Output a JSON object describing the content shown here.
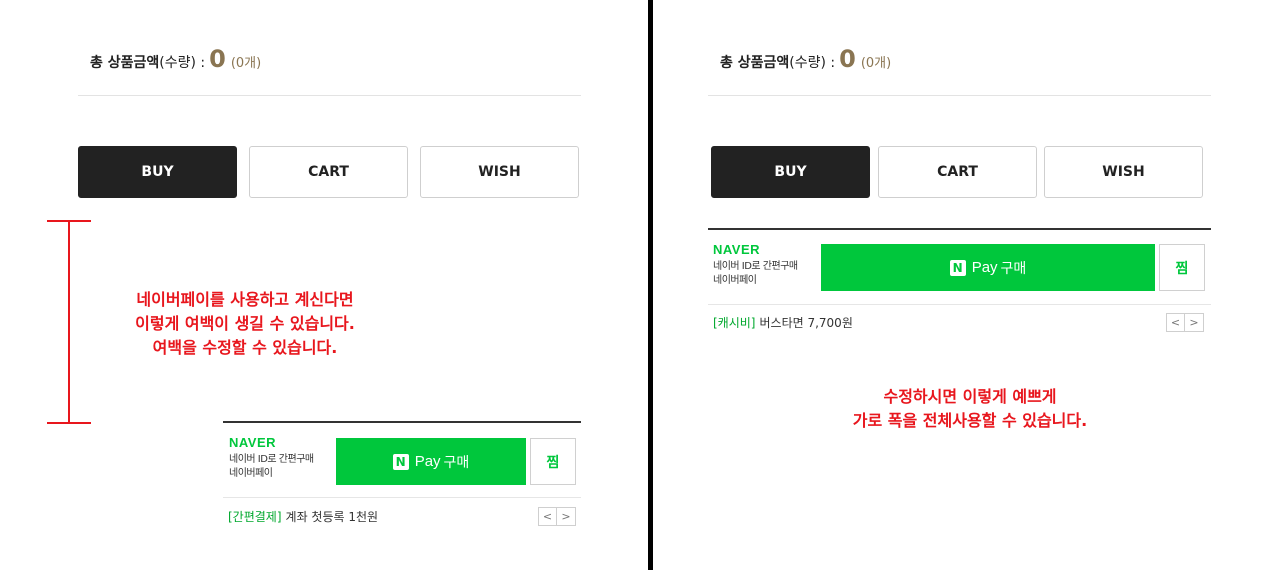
{
  "left": {
    "total": {
      "label_bold": "총 상품금액",
      "label_rest": "(수량) :",
      "amount": "0",
      "count": "(0개)"
    },
    "buttons": {
      "buy": "BUY",
      "cart": "CART",
      "wish": "WISH"
    },
    "annotation": {
      "line1": "네이버페이를 사용하고 계신다면",
      "line2": "이렇게 여백이 생길 수 있습니다.",
      "line3": "여백을 수정할 수 있습니다."
    },
    "naverpay": {
      "logo": "NAVER",
      "sub1": "네이버 ID로 간편구매",
      "sub2": "네이버페이",
      "pay_n": "N",
      "pay_label": "Pay",
      "pay_buy": "구매",
      "zzim": "찜",
      "promo_tag": "[간편결제]",
      "promo_text": "계좌 첫등록 1천원",
      "prev": "<",
      "next": ">"
    }
  },
  "right": {
    "total": {
      "label_bold": "총 상품금액",
      "label_rest": "(수량) :",
      "amount": "0",
      "count": "(0개)"
    },
    "buttons": {
      "buy": "BUY",
      "cart": "CART",
      "wish": "WISH"
    },
    "naverpay": {
      "logo": "NAVER",
      "sub1": "네이버 ID로 간편구매",
      "sub2": "네이버페이",
      "pay_n": "N",
      "pay_label": "Pay",
      "pay_buy": "구매",
      "zzim": "찜",
      "promo_tag": "[캐시비]",
      "promo_text": "버스타면 7,700원",
      "prev": "<",
      "next": ">"
    },
    "annotation": {
      "line1": "수정하시면 이렇게 예쁘게",
      "line2": "가로 폭을 전체사용할 수 있습니다."
    }
  },
  "colors": {
    "accent_gold": "#8a7552",
    "naver_green": "#00c73c",
    "annotation_red": "#e8161d",
    "buy_dark": "#222222"
  }
}
